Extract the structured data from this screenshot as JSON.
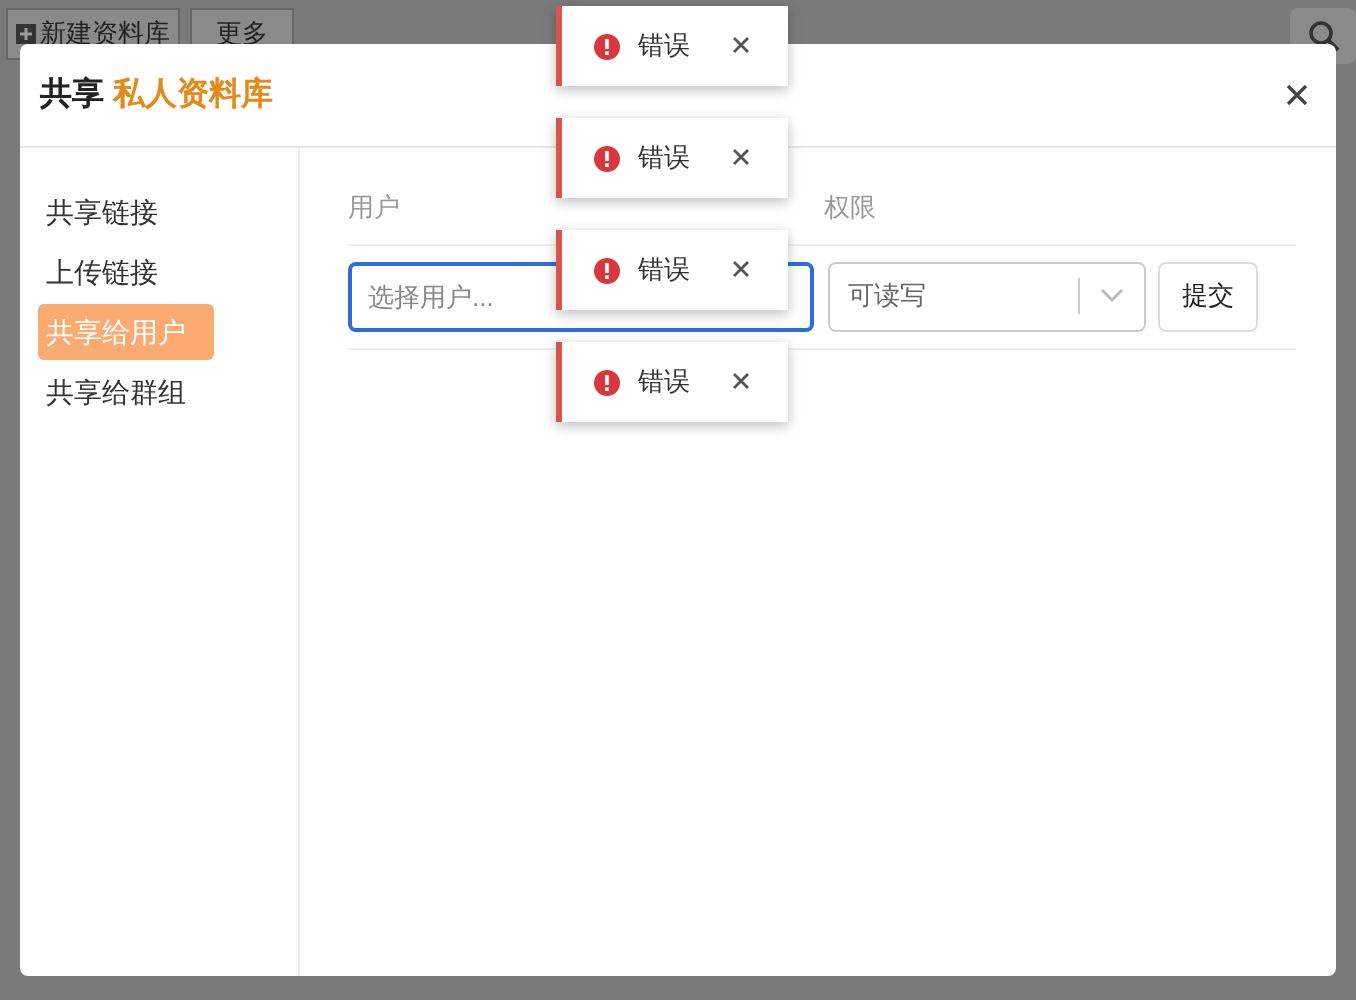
{
  "toolbar": {
    "buttons": [
      "新建资料库",
      "更多"
    ]
  },
  "dialog": {
    "title_prefix": "共享",
    "title_name": "私人资料库"
  },
  "sidebar": {
    "items": [
      {
        "label": "共享链接",
        "selected": false
      },
      {
        "label": "上传链接",
        "selected": false
      },
      {
        "label": "共享给用户",
        "selected": true
      },
      {
        "label": "共享给群组",
        "selected": false
      }
    ]
  },
  "form": {
    "columns": [
      "用户",
      "权限"
    ],
    "user_placeholder": "选择用户...",
    "permission": "可读写",
    "submit": "提交"
  },
  "toasts": [
    {
      "message": "错误"
    },
    {
      "message": "错误"
    },
    {
      "message": "错误"
    },
    {
      "message": "错误"
    }
  ]
}
